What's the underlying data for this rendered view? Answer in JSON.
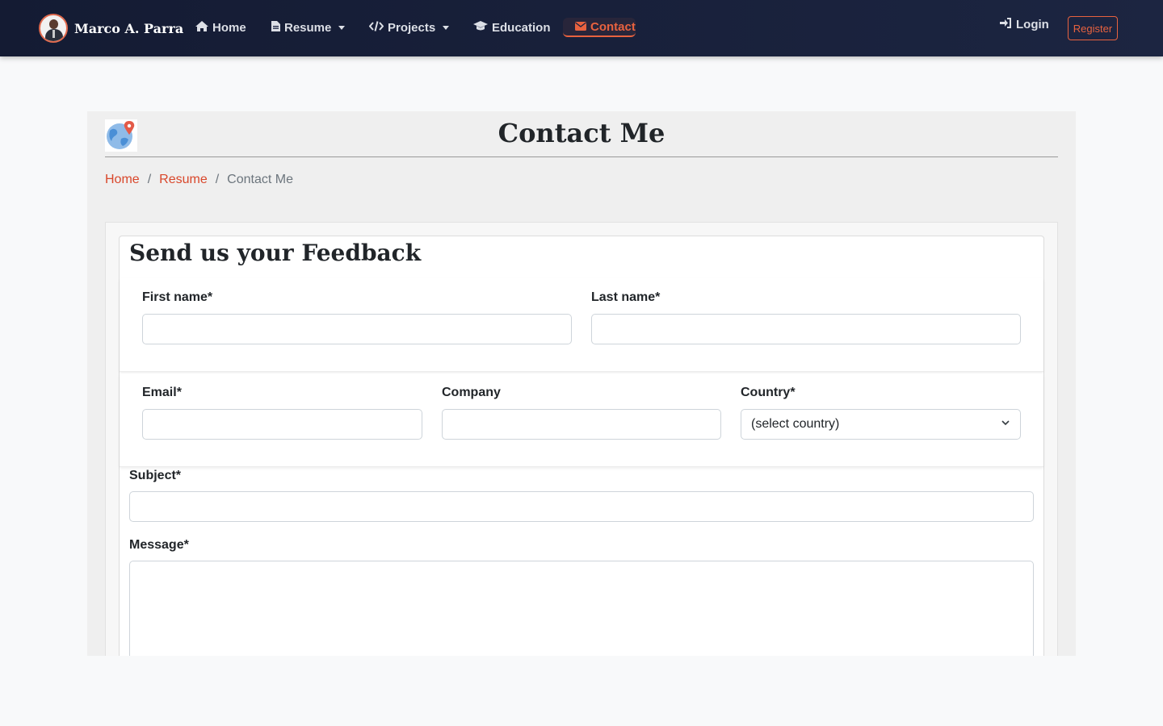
{
  "navbar": {
    "brand_name": "Marco A. Parra",
    "items": [
      {
        "label": "Home",
        "icon": "home-icon"
      },
      {
        "label": "Resume",
        "icon": "file-icon"
      },
      {
        "label": "Projects",
        "icon": "code-icon"
      },
      {
        "label": "Education",
        "icon": "graduation-cap-icon"
      },
      {
        "label": "Contact",
        "icon": "envelope-icon"
      }
    ],
    "login_label": "Login",
    "register_label": "Register",
    "accent_color": "#e8623f"
  },
  "page": {
    "title": "Contact Me",
    "breadcrumb": [
      "Home",
      "Resume",
      "Contact Me"
    ]
  },
  "form": {
    "title": "Send us your Feedback",
    "first_name_label": "First name*",
    "last_name_label": "Last name*",
    "email_label": "Email*",
    "company_label": "Company",
    "country_label": "Country*",
    "country_selected": "(select country)",
    "subject_label": "Subject*",
    "message_label": "Message*"
  }
}
